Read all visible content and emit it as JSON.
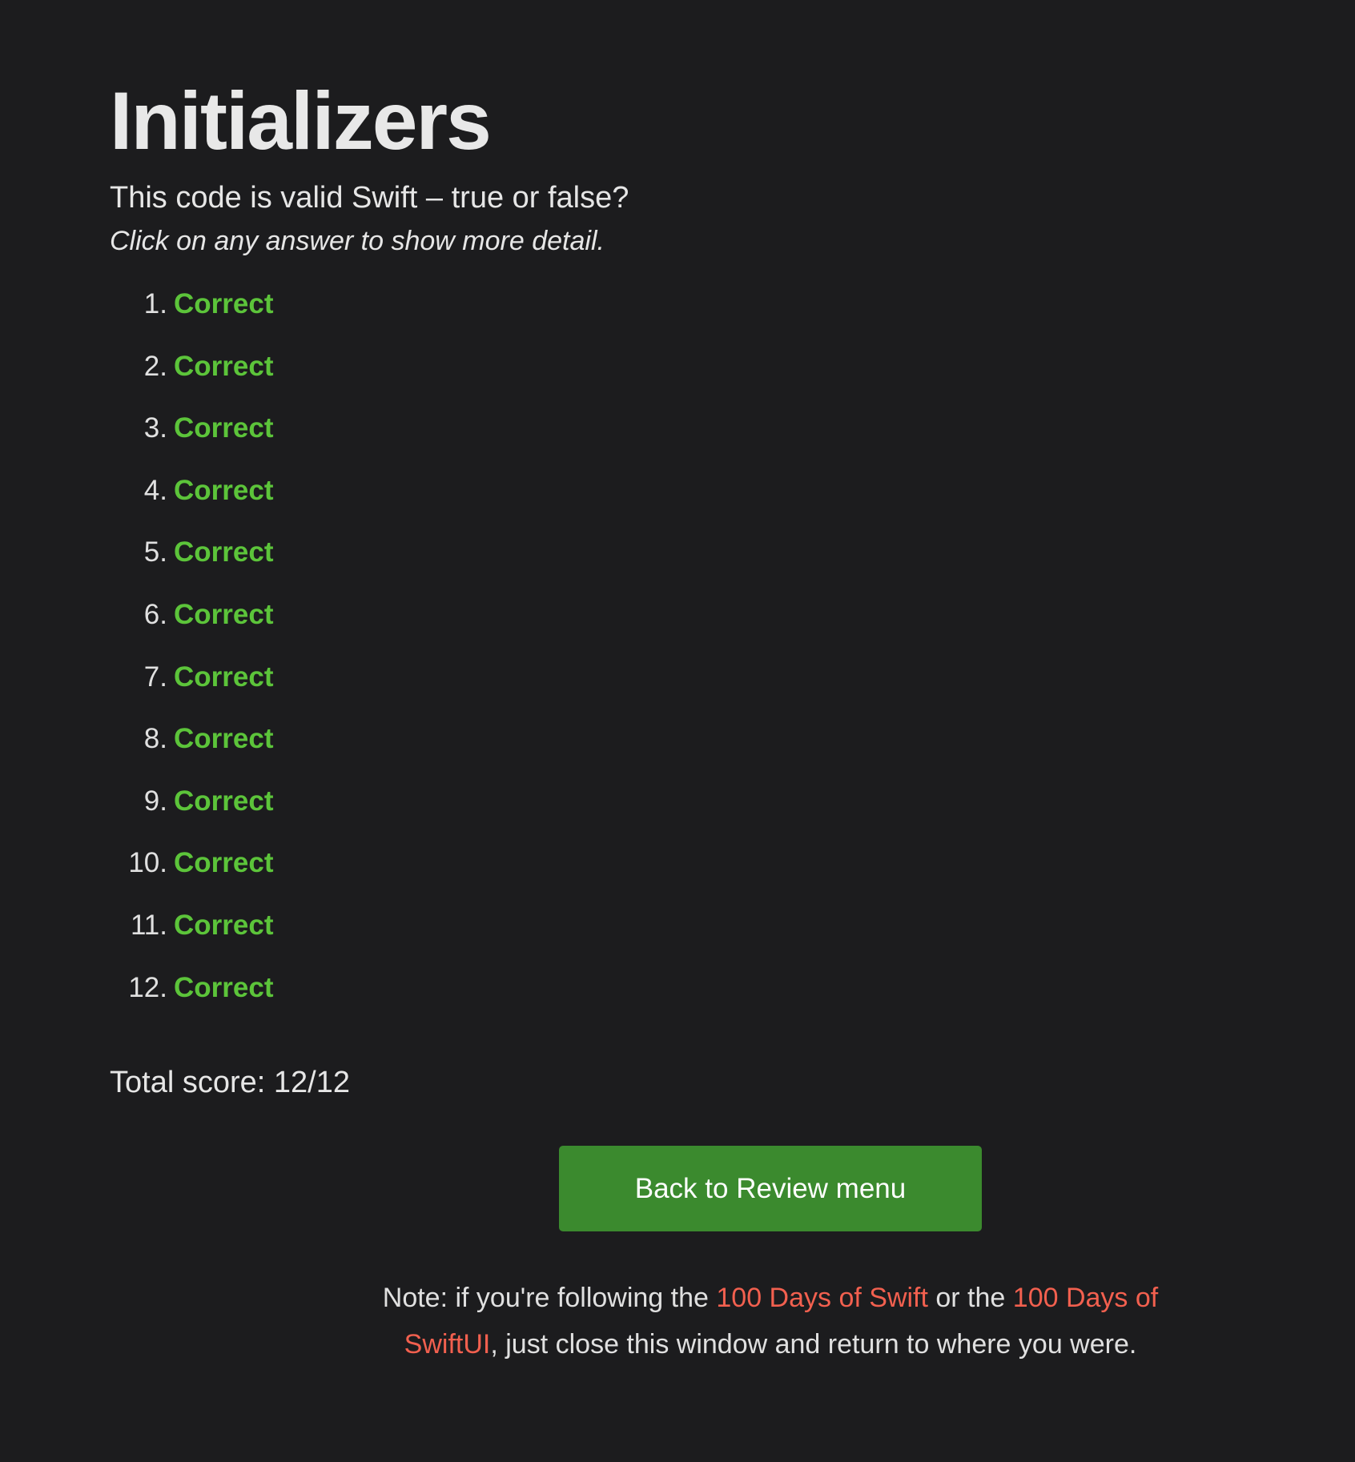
{
  "page": {
    "title": "Initializers",
    "subtitle": "This code is valid Swift – true or false?",
    "hint": "Click on any answer to show more detail."
  },
  "answers": [
    {
      "number": "1.",
      "status": "Correct"
    },
    {
      "number": "2.",
      "status": "Correct"
    },
    {
      "number": "3.",
      "status": "Correct"
    },
    {
      "number": "4.",
      "status": "Correct"
    },
    {
      "number": "5.",
      "status": "Correct"
    },
    {
      "number": "6.",
      "status": "Correct"
    },
    {
      "number": "7.",
      "status": "Correct"
    },
    {
      "number": "8.",
      "status": "Correct"
    },
    {
      "number": "9.",
      "status": "Correct"
    },
    {
      "number": "10.",
      "status": "Correct"
    },
    {
      "number": "11.",
      "status": "Correct"
    },
    {
      "number": "12.",
      "status": "Correct"
    }
  ],
  "score": {
    "text": "Total score: 12/12"
  },
  "actions": {
    "back_label": "Back to Review menu"
  },
  "note": {
    "prefix": "Note: if you're following the ",
    "link1": "100 Days of Swift",
    "middle": " or the ",
    "link2": "100 Days of SwiftUI",
    "suffix": ", just close this window and return to where you were."
  },
  "colors": {
    "background": "#1c1c1e",
    "correct": "#5cc43a",
    "button": "#3b8a2e",
    "link": "#f2604f"
  }
}
